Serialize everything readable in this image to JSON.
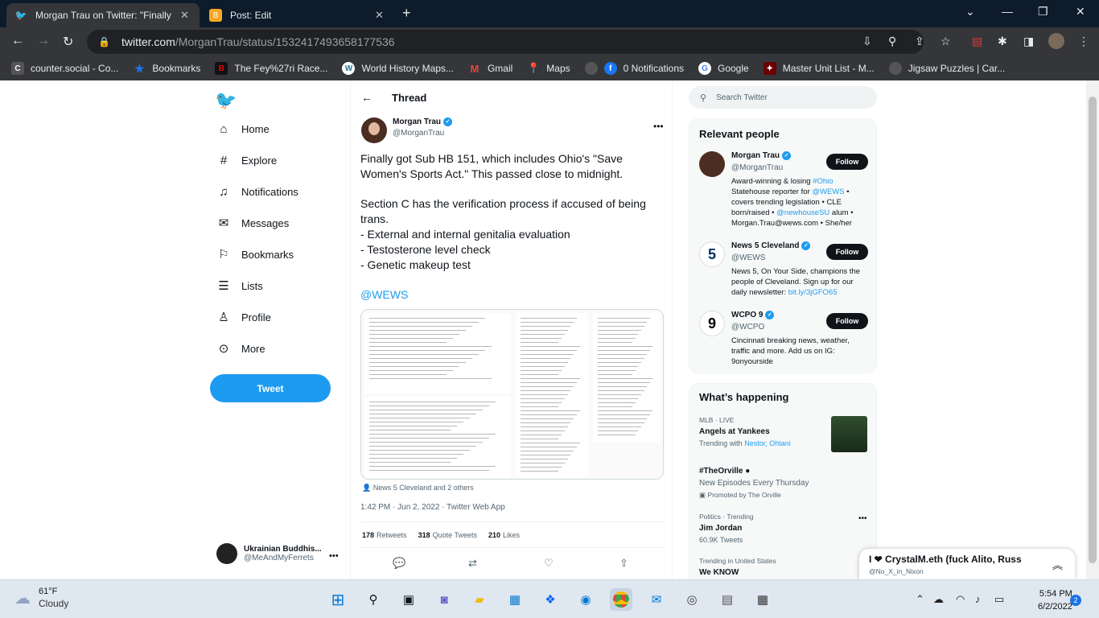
{
  "browser": {
    "tabs": [
      {
        "title": "Morgan Trau on Twitter: \"Finally g",
        "active": true
      },
      {
        "title": "Post: Edit",
        "active": false
      }
    ],
    "url_host": "twitter.com",
    "url_path": "/MorganTrau/status/1532417493658177536",
    "bookmarks": [
      {
        "label": "counter.social - Co...",
        "icon": "c-icon",
        "color": "#444"
      },
      {
        "label": "Bookmarks",
        "icon": "star-icon",
        "color": "#1a73e8"
      },
      {
        "label": "The Fey%27ri Race...",
        "icon": "b-icon",
        "color": "#c00"
      },
      {
        "label": "World History Maps...",
        "icon": "wordpress-icon",
        "color": "#21759b"
      },
      {
        "label": "Gmail",
        "icon": "gmail-icon",
        "color": "#ea4335"
      },
      {
        "label": "Maps",
        "icon": "maps-icon",
        "color": "#34a853"
      },
      {
        "label": "0 Notifications",
        "icon": "facebook-icon",
        "color": "#1877f2"
      },
      {
        "label": "Google",
        "icon": "google-icon",
        "color": "#4285f4"
      },
      {
        "label": "Master Unit List - M...",
        "icon": "mul-icon",
        "color": "#8b0000"
      },
      {
        "label": "Jigsaw Puzzles | Car...",
        "icon": "globe-icon",
        "color": "#666"
      }
    ]
  },
  "nav": {
    "items": [
      {
        "label": "Home",
        "icon": "home-icon"
      },
      {
        "label": "Explore",
        "icon": "hashtag-icon"
      },
      {
        "label": "Notifications",
        "icon": "bell-icon"
      },
      {
        "label": "Messages",
        "icon": "mail-icon"
      },
      {
        "label": "Bookmarks",
        "icon": "bookmark-icon"
      },
      {
        "label": "Lists",
        "icon": "list-icon"
      },
      {
        "label": "Profile",
        "icon": "person-icon"
      },
      {
        "label": "More",
        "icon": "more-circle-icon"
      }
    ],
    "tweet_button": "Tweet",
    "account": {
      "name": "Ukrainian Buddhis...",
      "handle": "@MeAndMyFerrets"
    }
  },
  "thread": {
    "header": "Thread",
    "author_name": "Morgan Trau",
    "author_handle": "@MorganTrau",
    "p1": "Finally got Sub HB 151, which includes Ohio's \"Save Women's Sports Act.\" This passed close to midnight.",
    "p2_line1": "Section C has the verification process if accused of being trans.",
    "p2_line2": "- External and internal genitalia evaluation",
    "p2_line3": "- Testosterone level check",
    "p2_line4": "- Genetic makeup test",
    "mention": "@WEWS",
    "tagged": "News 5 Cleveland and 2 others",
    "timestamp": "1:42 PM · Jun 2, 2022 · Twitter Web App",
    "retweets_count": "178",
    "retweets_label": "Retweets",
    "quotes_count": "318",
    "quotes_label": "Quote Tweets",
    "likes_count": "210",
    "likes_label": "Likes"
  },
  "right": {
    "search_placeholder": "Search Twitter",
    "relevant_title": "Relevant people",
    "people": [
      {
        "name": "Morgan Trau",
        "handle": "@MorganTrau",
        "follow": "Follow",
        "bio_a": "Award-winning & losing ",
        "bio_link1": "#Ohio",
        "bio_b": " Statehouse reporter for ",
        "bio_link2": "@WEWS",
        "bio_c": " • covers trending legislation • CLE born/raised • ",
        "bio_link3": "@newhouseSU",
        "bio_d": " alum • Morgan.Trau@wews.com • She/her"
      },
      {
        "name": "News 5 Cleveland",
        "handle": "@WEWS",
        "follow": "Follow",
        "bio_a": "News 5, On Your Side, champions the people of Cleveland. Sign up for our daily newsletter: ",
        "bio_link1": "bit.ly/3jGFO65"
      },
      {
        "name": "WCPO 9",
        "handle": "@WCPO",
        "follow": "Follow",
        "bio_a": "Cincinnati breaking news, weather, traffic and more. Add us on IG: 9onyourside"
      }
    ],
    "happening_title": "What’s happening",
    "trends": [
      {
        "cat": "MLB · LIVE",
        "title": "Angels at Yankees",
        "sub_a": "Trending with ",
        "sub_link": "Nestor, Ohtani"
      },
      {
        "cat": "",
        "title": "#TheOrville",
        "sub_a": "New Episodes Every Thursday",
        "promo": "Promoted by The Orville"
      },
      {
        "cat": "Politics · Trending",
        "title": "Jim Jordan",
        "sub_a": "60.9K Tweets"
      },
      {
        "cat": "Trending in United States",
        "title": "We KNOW",
        "sub_a": ""
      }
    ]
  },
  "dm": {
    "title": "I ❤ CrystalM.eth (fuck Alito, Russ",
    "handle": "@No_X_in_Nixon"
  },
  "taskbar": {
    "temp": "61°F",
    "condition": "Cloudy",
    "time": "5:54 PM",
    "date": "6/2/2022",
    "notifications": "2"
  }
}
